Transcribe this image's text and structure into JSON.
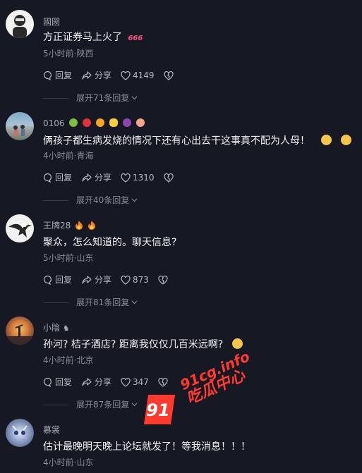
{
  "comments": [
    {
      "username": "國圀",
      "text": "方正证券马上火了",
      "meta": "5小时前·陕西",
      "reply_label": "回复",
      "share_label": "分享",
      "likes": "4149",
      "expand_label": "展开71条回复",
      "text_badge": "666"
    },
    {
      "username": "0106",
      "text": "俩孩子都生病发烧的情况下还有心出去干这事真不配为人母！",
      "meta": "4小时前·青海",
      "reply_label": "回复",
      "share_label": "分享",
      "likes": "1310",
      "expand_label": "展开40条回复"
    },
    {
      "username": "王牌28",
      "text": "聚众，怎么知道的。聊天信息?",
      "meta": "5小时前·山东",
      "reply_label": "回复",
      "share_label": "分享",
      "likes": "873",
      "expand_label": "展开81条回复"
    },
    {
      "username": "小陰",
      "text": "孙河? 桔子酒店? 距离我仅仅几百米远啊?",
      "meta": "4小时前·北京",
      "reply_label": "回复",
      "share_label": "分享",
      "likes": "347",
      "expand_label": "展开87条回复"
    },
    {
      "username": "慕裳",
      "text": "估计最晚明天晚上论坛就发了！等我消息！！！",
      "meta": "4小时前·山东"
    }
  ],
  "watermark": {
    "number": "91",
    "url": "91cg.info",
    "name": "吃瓜中心"
  },
  "colors": {
    "background": "#161823",
    "watermark": "#ff3b2f"
  }
}
